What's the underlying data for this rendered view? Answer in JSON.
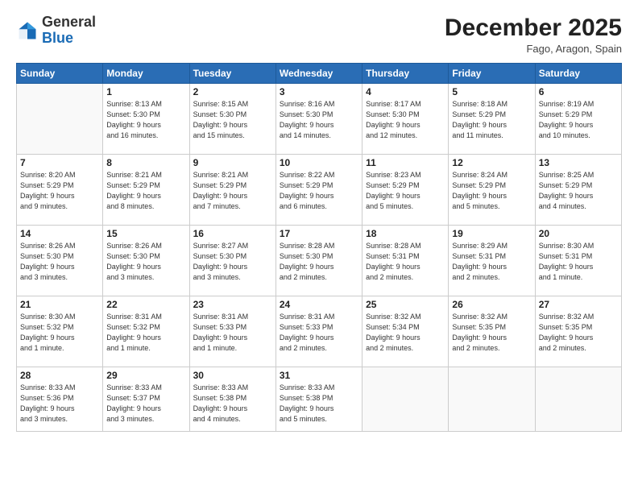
{
  "logo": {
    "general": "General",
    "blue": "Blue"
  },
  "title": "December 2025",
  "location": "Fago, Aragon, Spain",
  "days_of_week": [
    "Sunday",
    "Monday",
    "Tuesday",
    "Wednesday",
    "Thursday",
    "Friday",
    "Saturday"
  ],
  "weeks": [
    [
      {
        "num": "",
        "info": ""
      },
      {
        "num": "1",
        "info": "Sunrise: 8:13 AM\nSunset: 5:30 PM\nDaylight: 9 hours\nand 16 minutes."
      },
      {
        "num": "2",
        "info": "Sunrise: 8:15 AM\nSunset: 5:30 PM\nDaylight: 9 hours\nand 15 minutes."
      },
      {
        "num": "3",
        "info": "Sunrise: 8:16 AM\nSunset: 5:30 PM\nDaylight: 9 hours\nand 14 minutes."
      },
      {
        "num": "4",
        "info": "Sunrise: 8:17 AM\nSunset: 5:30 PM\nDaylight: 9 hours\nand 12 minutes."
      },
      {
        "num": "5",
        "info": "Sunrise: 8:18 AM\nSunset: 5:29 PM\nDaylight: 9 hours\nand 11 minutes."
      },
      {
        "num": "6",
        "info": "Sunrise: 8:19 AM\nSunset: 5:29 PM\nDaylight: 9 hours\nand 10 minutes."
      }
    ],
    [
      {
        "num": "7",
        "info": "Sunrise: 8:20 AM\nSunset: 5:29 PM\nDaylight: 9 hours\nand 9 minutes."
      },
      {
        "num": "8",
        "info": "Sunrise: 8:21 AM\nSunset: 5:29 PM\nDaylight: 9 hours\nand 8 minutes."
      },
      {
        "num": "9",
        "info": "Sunrise: 8:21 AM\nSunset: 5:29 PM\nDaylight: 9 hours\nand 7 minutes."
      },
      {
        "num": "10",
        "info": "Sunrise: 8:22 AM\nSunset: 5:29 PM\nDaylight: 9 hours\nand 6 minutes."
      },
      {
        "num": "11",
        "info": "Sunrise: 8:23 AM\nSunset: 5:29 PM\nDaylight: 9 hours\nand 5 minutes."
      },
      {
        "num": "12",
        "info": "Sunrise: 8:24 AM\nSunset: 5:29 PM\nDaylight: 9 hours\nand 5 minutes."
      },
      {
        "num": "13",
        "info": "Sunrise: 8:25 AM\nSunset: 5:29 PM\nDaylight: 9 hours\nand 4 minutes."
      }
    ],
    [
      {
        "num": "14",
        "info": "Sunrise: 8:26 AM\nSunset: 5:30 PM\nDaylight: 9 hours\nand 3 minutes."
      },
      {
        "num": "15",
        "info": "Sunrise: 8:26 AM\nSunset: 5:30 PM\nDaylight: 9 hours\nand 3 minutes."
      },
      {
        "num": "16",
        "info": "Sunrise: 8:27 AM\nSunset: 5:30 PM\nDaylight: 9 hours\nand 3 minutes."
      },
      {
        "num": "17",
        "info": "Sunrise: 8:28 AM\nSunset: 5:30 PM\nDaylight: 9 hours\nand 2 minutes."
      },
      {
        "num": "18",
        "info": "Sunrise: 8:28 AM\nSunset: 5:31 PM\nDaylight: 9 hours\nand 2 minutes."
      },
      {
        "num": "19",
        "info": "Sunrise: 8:29 AM\nSunset: 5:31 PM\nDaylight: 9 hours\nand 2 minutes."
      },
      {
        "num": "20",
        "info": "Sunrise: 8:30 AM\nSunset: 5:31 PM\nDaylight: 9 hours\nand 1 minute."
      }
    ],
    [
      {
        "num": "21",
        "info": "Sunrise: 8:30 AM\nSunset: 5:32 PM\nDaylight: 9 hours\nand 1 minute."
      },
      {
        "num": "22",
        "info": "Sunrise: 8:31 AM\nSunset: 5:32 PM\nDaylight: 9 hours\nand 1 minute."
      },
      {
        "num": "23",
        "info": "Sunrise: 8:31 AM\nSunset: 5:33 PM\nDaylight: 9 hours\nand 1 minute."
      },
      {
        "num": "24",
        "info": "Sunrise: 8:31 AM\nSunset: 5:33 PM\nDaylight: 9 hours\nand 2 minutes."
      },
      {
        "num": "25",
        "info": "Sunrise: 8:32 AM\nSunset: 5:34 PM\nDaylight: 9 hours\nand 2 minutes."
      },
      {
        "num": "26",
        "info": "Sunrise: 8:32 AM\nSunset: 5:35 PM\nDaylight: 9 hours\nand 2 minutes."
      },
      {
        "num": "27",
        "info": "Sunrise: 8:32 AM\nSunset: 5:35 PM\nDaylight: 9 hours\nand 2 minutes."
      }
    ],
    [
      {
        "num": "28",
        "info": "Sunrise: 8:33 AM\nSunset: 5:36 PM\nDaylight: 9 hours\nand 3 minutes."
      },
      {
        "num": "29",
        "info": "Sunrise: 8:33 AM\nSunset: 5:37 PM\nDaylight: 9 hours\nand 3 minutes."
      },
      {
        "num": "30",
        "info": "Sunrise: 8:33 AM\nSunset: 5:38 PM\nDaylight: 9 hours\nand 4 minutes."
      },
      {
        "num": "31",
        "info": "Sunrise: 8:33 AM\nSunset: 5:38 PM\nDaylight: 9 hours\nand 5 minutes."
      },
      {
        "num": "",
        "info": ""
      },
      {
        "num": "",
        "info": ""
      },
      {
        "num": "",
        "info": ""
      }
    ]
  ]
}
